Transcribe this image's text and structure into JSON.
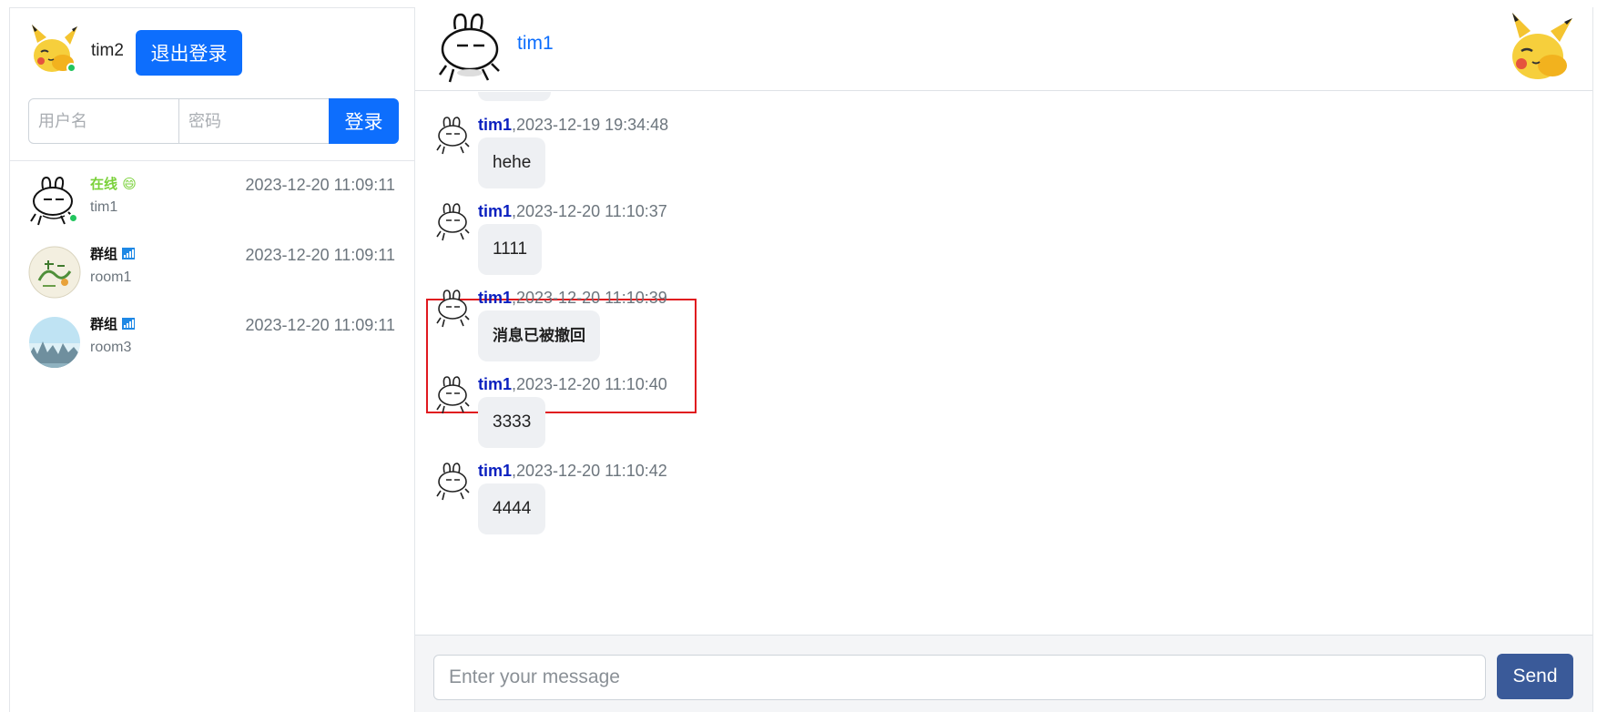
{
  "colors": {
    "primary": "#0d6efd",
    "send": "#3a5a99",
    "online": "#22c55e",
    "online_text": "#7ad13a",
    "author": "#0a1fbf",
    "highlight": "#e0191f"
  },
  "sidebar": {
    "me": {
      "name": "tim2",
      "avatar_icon": "pikachu-avatar-icon",
      "online": true
    },
    "logout_label": "退出登录",
    "login": {
      "username_placeholder": "用户名",
      "password_placeholder": "密码",
      "button_label": "登录"
    },
    "conversations": [
      {
        "status": "在线",
        "status_emoji": "😄",
        "name": "tim1",
        "time": "2023-12-20 11:09:11",
        "avatar_icon": "rabbit-avatar-icon",
        "online": true
      },
      {
        "status": "群组",
        "status_icon": "signal-icon",
        "name": "room1",
        "time": "2023-12-20 11:09:11",
        "avatar_icon": "group-avatar-icon"
      },
      {
        "status": "群组",
        "status_icon": "signal-icon",
        "name": "room3",
        "time": "2023-12-20 11:09:11",
        "avatar_icon": "landscape-avatar-icon"
      }
    ]
  },
  "chat": {
    "header": {
      "name": "tim1",
      "avatar_icon": "rabbit-avatar-icon",
      "right_icon": "pikachu-icon"
    },
    "messages": [
      {
        "author": "tim1",
        "time": ",2023-12-19 19:34:48",
        "text": "hehe"
      },
      {
        "author": "tim1",
        "time": ",2023-12-20 11:10:37",
        "text": "1111"
      },
      {
        "author": "tim1",
        "time": ",2023-12-20 11:10:39",
        "text": "消息已被撤回",
        "recalled": true,
        "highlighted": true
      },
      {
        "author": "tim1",
        "time": ",2023-12-20 11:10:40",
        "text": "3333"
      },
      {
        "author": "tim1",
        "time": ",2023-12-20 11:10:42",
        "text": "4444"
      }
    ],
    "input": {
      "placeholder": "Enter your message",
      "value": ""
    },
    "send_label": "Send"
  }
}
